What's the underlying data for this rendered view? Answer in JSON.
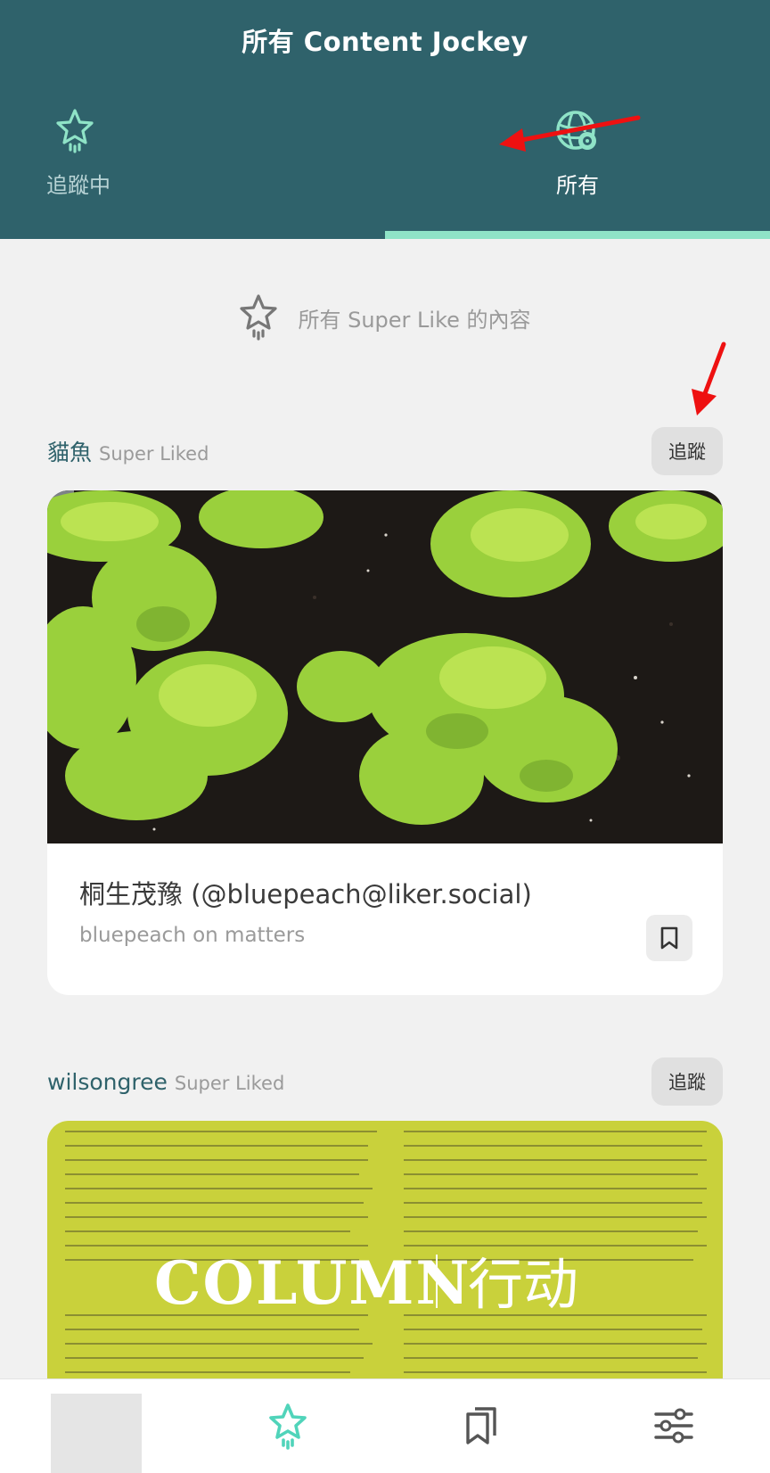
{
  "header": {
    "title": "所有 Content Jockey",
    "tabs": [
      {
        "label": "追蹤中",
        "icon": "star-icon",
        "active": false
      },
      {
        "label": "所有",
        "icon": "globe-icon",
        "active": true
      }
    ],
    "colors": {
      "background": "#2f626b",
      "active_indicator": "#8fe3c7",
      "arrow": "#ee1111"
    }
  },
  "banner": {
    "text": "所有 Super Like 的內容",
    "icon": "star-icon"
  },
  "feed": [
    {
      "user": "貓魚",
      "status": "Super Liked",
      "follow_label": "追蹤",
      "image": "lettuce-photo",
      "title": "桐生茂豫 (@bluepeach@liker.social)",
      "subtitle": "bluepeach on matters",
      "bookmark_icon": "bookmark-icon"
    },
    {
      "user": "wilsongree",
      "status": "Super Liked",
      "follow_label": "追蹤",
      "image": "document-photo",
      "overlay_text": "COLUMN",
      "overlay_text_cn": "行动"
    }
  ],
  "bottom_nav": {
    "items": [
      "avatar",
      "star-icon",
      "bookmarks-icon",
      "settings-sliders-icon"
    ],
    "active": "star-icon"
  }
}
